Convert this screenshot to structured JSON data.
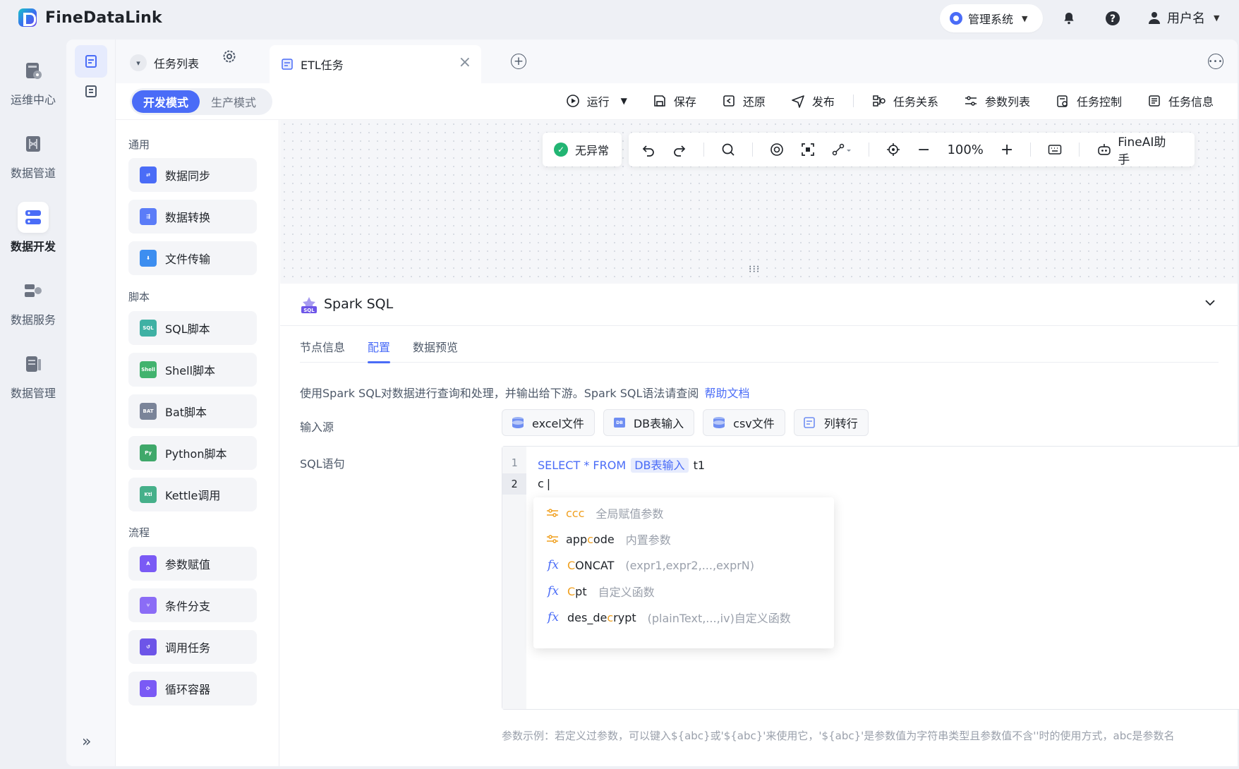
{
  "app": {
    "name": "FineDataLink"
  },
  "header": {
    "system_label": "管理系统",
    "user_label": "用户名"
  },
  "leftnav": [
    {
      "label": "运维中心"
    },
    {
      "label": "数据管道"
    },
    {
      "label": "数据开发"
    },
    {
      "label": "数据服务"
    },
    {
      "label": "数据管理"
    }
  ],
  "tabs": {
    "list_label": "任务列表",
    "active_label": "ETL任务"
  },
  "toolbar": {
    "mode_dev": "开发模式",
    "mode_prod": "生产模式",
    "run": "运行",
    "save": "保存",
    "restore": "还原",
    "publish": "发布",
    "relations": "任务关系",
    "params": "参数列表",
    "control": "任务控制",
    "info": "任务信息"
  },
  "palette": {
    "sections": [
      "通用",
      "脚本",
      "流程"
    ],
    "general": [
      "数据同步",
      "数据转换",
      "文件传输"
    ],
    "scripts": [
      "SQL脚本",
      "Shell脚本",
      "Bat脚本",
      "Python脚本",
      "Kettle调用"
    ],
    "flow": [
      "参数赋值",
      "条件分支",
      "调用任务",
      "循环容器"
    ]
  },
  "canvas": {
    "status": "无异常",
    "zoom": "100%",
    "ai": "FineAI助手"
  },
  "panel": {
    "title": "Spark SQL",
    "tabs": [
      "节点信息",
      "配置",
      "数据预览"
    ],
    "description": "使用Spark SQL对数据进行查询和处理，并输出给下游。Spark SQL语法请查阅",
    "help_link": "帮助文档",
    "input_label": "输入源",
    "inputs": [
      "excel文件",
      "DB表输入",
      "csv文件",
      "列转行"
    ],
    "sql_label": "SQL语句",
    "code": {
      "line1_kw": "SELECT * FROM",
      "line1_token": "DB表输入",
      "line1_alias": "t1",
      "line2": "c"
    },
    "suggestions": [
      {
        "pre": "",
        "hl": "c",
        "post": "cc",
        "hint": "全局赋值参数",
        "hl_all": true
      },
      {
        "pre": "app",
        "hl": "c",
        "post": "ode",
        "hint": "内置参数"
      },
      {
        "pre": "",
        "hl": "C",
        "post": "ONCAT",
        "hint": "(expr1,expr2,...,exprN)"
      },
      {
        "pre": "",
        "hl": "C",
        "post": "pt",
        "hint": "自定义函数"
      },
      {
        "pre": "des_de",
        "hl": "c",
        "post": "rypt",
        "hint": "(plainText,...,iv)自定义函数"
      }
    ],
    "note": "参数示例：若定义过参数，可以键入${abc}或'${abc}'来使用它，'${abc}'是参数值为字符串类型且参数值不含''时的使用方式，abc是参数名"
  },
  "colors": {
    "accent": "#4a6cf7",
    "highlight": "#f0a020",
    "ok": "#22b573"
  }
}
